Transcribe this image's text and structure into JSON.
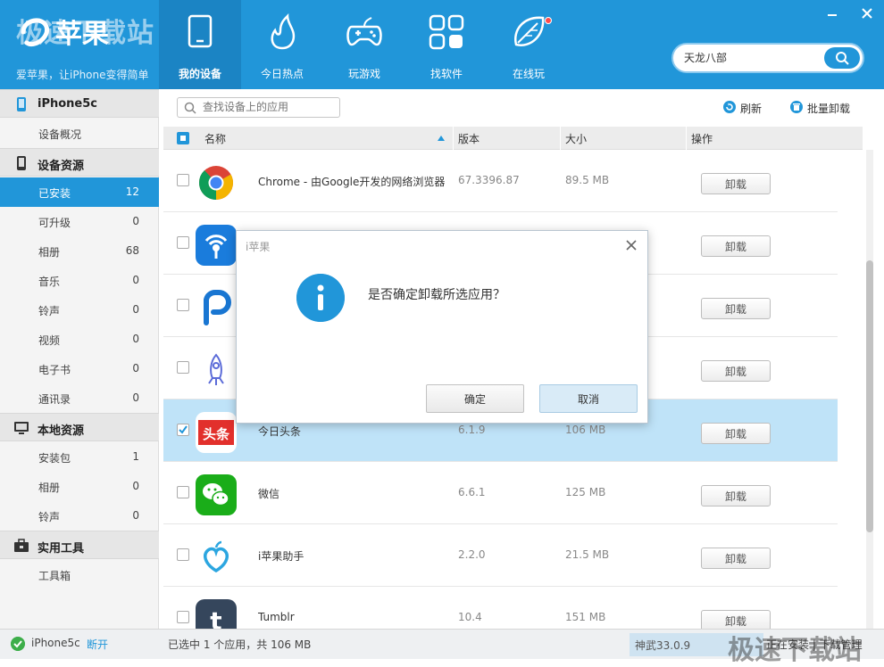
{
  "app": {
    "watermark": "极速下载站",
    "logo_text": "i苹果",
    "slogan": "爱苹果，让iPhone变得简单"
  },
  "nav": {
    "tabs": [
      {
        "label": "我的设备",
        "icon": "tablet-icon",
        "active": true
      },
      {
        "label": "今日热点",
        "icon": "flame-icon",
        "active": false
      },
      {
        "label": "玩游戏",
        "icon": "gamepad-icon",
        "active": false
      },
      {
        "label": "找软件",
        "icon": "apps-grid-icon",
        "active": false
      },
      {
        "label": "在线玩",
        "icon": "leaf-icon",
        "active": false,
        "badge": true
      }
    ]
  },
  "search": {
    "value": "天龙八部"
  },
  "sidebar": {
    "device": {
      "title": "iPhone5c",
      "items": [
        {
          "label": "设备概况"
        }
      ]
    },
    "resources": {
      "title": "设备资源",
      "items": [
        {
          "label": "已安装",
          "count": "12",
          "active": true
        },
        {
          "label": "可升级",
          "count": "0"
        },
        {
          "label": "相册",
          "count": "68"
        },
        {
          "label": "音乐",
          "count": "0"
        },
        {
          "label": "铃声",
          "count": "0"
        },
        {
          "label": "视频",
          "count": "0"
        },
        {
          "label": "电子书",
          "count": "0"
        },
        {
          "label": "通讯录",
          "count": "0"
        }
      ]
    },
    "local": {
      "title": "本地资源",
      "items": [
        {
          "label": "安装包",
          "count": "1"
        },
        {
          "label": "相册",
          "count": "0"
        },
        {
          "label": "铃声",
          "count": "0"
        }
      ]
    },
    "tools": {
      "title": "实用工具",
      "items": [
        {
          "label": "工具箱"
        }
      ]
    }
  },
  "toolbar": {
    "search_placeholder": "查找设备上的应用",
    "refresh": "刷新",
    "batch_uninstall": "批量卸载"
  },
  "table": {
    "columns": {
      "name": "名称",
      "version": "版本",
      "size": "大小",
      "action": "操作"
    },
    "uninstall_label": "卸载",
    "rows": [
      {
        "name": "Chrome - 由Google开发的网络浏览器",
        "version": "67.3396.87",
        "size": "89.5 MB",
        "icon": "chrome-icon",
        "checked": false
      },
      {
        "name": "",
        "version": "",
        "size": "",
        "icon": "wifi-key-icon",
        "checked": false
      },
      {
        "name": "",
        "version": "",
        "size": "",
        "icon": "pp-icon",
        "checked": false
      },
      {
        "name": "",
        "version": "",
        "size": "",
        "icon": "rocket-icon",
        "checked": false
      },
      {
        "name": "今日头条",
        "version": "6.1.9",
        "size": "106 MB",
        "icon": "toutiao-icon",
        "checked": true
      },
      {
        "name": "微信",
        "version": "6.6.1",
        "size": "125 MB",
        "icon": "wechat-icon",
        "checked": false
      },
      {
        "name": "i苹果助手",
        "version": "2.2.0",
        "size": "21.5 MB",
        "icon": "iapple-helper-icon",
        "checked": false
      },
      {
        "name": "Tumblr",
        "version": "10.4",
        "size": "151 MB",
        "icon": "tumblr-icon",
        "checked": false
      }
    ]
  },
  "status": {
    "device": "iPhone5c",
    "disconnect": "断开",
    "selection": "已选中 1 个应用，共 106 MB",
    "version": "神武33.0.9",
    "right": "正在安装 | 下载管理"
  },
  "dialog": {
    "title": "i苹果",
    "message": "是否确定卸载所选应用？",
    "ok": "确定",
    "cancel": "取消"
  },
  "colors": {
    "accent": "#2196d9",
    "selected_row": "#bfe3f8"
  }
}
